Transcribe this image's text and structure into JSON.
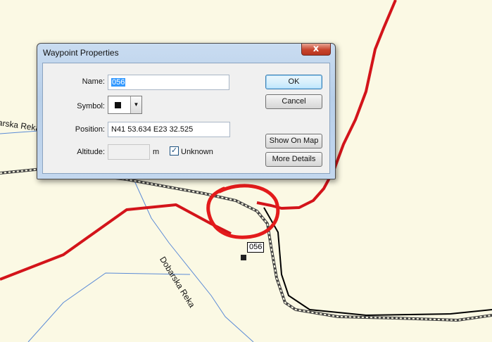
{
  "map": {
    "river_label_1": "Dobarska Reka",
    "river_label_2": "arska Reka",
    "waypoint_label": "056"
  },
  "dialog": {
    "title": "Waypoint Properties",
    "close_glyph": "x",
    "name_label": "Name:",
    "name_value": "056",
    "symbol_label": "Symbol:",
    "dropdown_glyph": "▼",
    "position_label": "Position:",
    "position_value": "N41 53.634 E23 32.525",
    "altitude_label": "Altitude:",
    "altitude_value": "",
    "altitude_unit": "m",
    "unknown_label": "Unknown",
    "unknown_checked": true,
    "checkmark": "✓",
    "ok_label": "OK",
    "cancel_label": "Cancel",
    "show_on_map_label": "Show On Map",
    "more_details_label": "More Details"
  },
  "colors": {
    "map_background": "#fbf9e4",
    "road": "#d3141a",
    "river": "#5b8bd6",
    "track": "#000000",
    "annotation_circle": "#e31b1b"
  }
}
